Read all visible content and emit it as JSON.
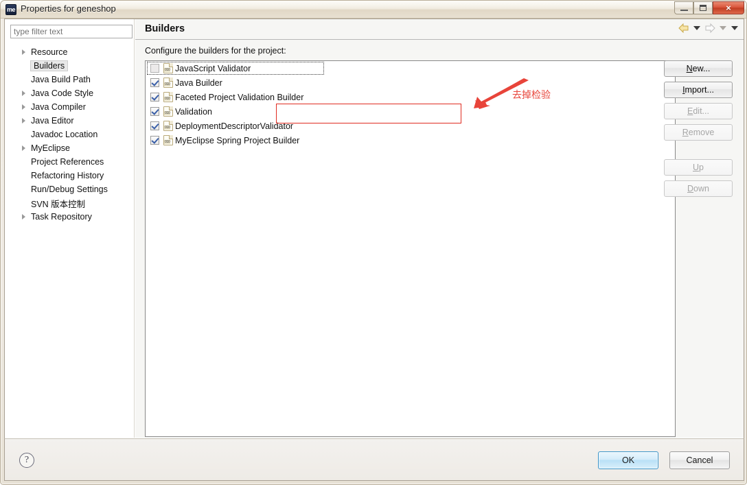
{
  "window": {
    "title": "Properties for geneshop",
    "app_icon": "me",
    "controls": {
      "minimize": "minimize-icon",
      "restore": "restore-icon",
      "close": "×"
    }
  },
  "sidebar": {
    "filter": {
      "placeholder": "type filter text",
      "value": ""
    },
    "items": [
      {
        "label": "Resource",
        "expandable": true,
        "selected": false
      },
      {
        "label": "Builders",
        "expandable": false,
        "selected": true
      },
      {
        "label": "Java Build Path",
        "expandable": false,
        "selected": false
      },
      {
        "label": "Java Code Style",
        "expandable": true,
        "selected": false
      },
      {
        "label": "Java Compiler",
        "expandable": true,
        "selected": false
      },
      {
        "label": "Java Editor",
        "expandable": true,
        "selected": false
      },
      {
        "label": "Javadoc Location",
        "expandable": false,
        "selected": false
      },
      {
        "label": "MyEclipse",
        "expandable": true,
        "selected": false
      },
      {
        "label": "Project References",
        "expandable": false,
        "selected": false
      },
      {
        "label": "Refactoring History",
        "expandable": false,
        "selected": false
      },
      {
        "label": "Run/Debug Settings",
        "expandable": false,
        "selected": false
      },
      {
        "label": "SVN 版本控制",
        "expandable": false,
        "selected": false
      },
      {
        "label": "Task Repository",
        "expandable": true,
        "selected": false
      }
    ]
  },
  "page": {
    "title": "Builders",
    "description": "Configure the builders for the project:",
    "nav": {
      "back_icon": "back-arrow-icon",
      "back_menu_icon": "chevron-down-icon",
      "forward_icon": "forward-arrow-icon",
      "forward_menu_icon": "chevron-down-icon",
      "view_menu_icon": "chevron-down-icon"
    }
  },
  "builders": [
    {
      "name": "JavaScript Validator",
      "checked": false,
      "focused": true
    },
    {
      "name": "Java Builder",
      "checked": true,
      "focused": false
    },
    {
      "name": "Faceted Project Validation Builder",
      "checked": true,
      "focused": false
    },
    {
      "name": "Validation",
      "checked": true,
      "focused": false
    },
    {
      "name": "DeploymentDescriptorValidator",
      "checked": true,
      "focused": false
    },
    {
      "name": "MyEclipse Spring Project Builder",
      "checked": true,
      "focused": false
    }
  ],
  "side_buttons": [
    {
      "label": "New...",
      "mnemonic": "N",
      "enabled": true,
      "gap_after": false
    },
    {
      "label": "Import...",
      "mnemonic": "I",
      "enabled": true,
      "gap_after": false
    },
    {
      "label": "Edit...",
      "mnemonic": "E",
      "enabled": false,
      "gap_after": false
    },
    {
      "label": "Remove",
      "mnemonic": "R",
      "enabled": false,
      "gap_after": true
    },
    {
      "label": "Up",
      "mnemonic": "U",
      "enabled": false,
      "gap_after": false
    },
    {
      "label": "Down",
      "mnemonic": "D",
      "enabled": false,
      "gap_after": false
    }
  ],
  "footer": {
    "help_icon": "?",
    "ok_label": "OK",
    "cancel_label": "Cancel"
  },
  "annotation": {
    "text": "去掉检验",
    "color": "#e8443a",
    "box_color": "#e02b20"
  },
  "colors": {
    "accent": "#3c94c8",
    "annotation_red": "#e02b20",
    "title_bg": "#efebe3",
    "list_bg": "#ffffff"
  }
}
